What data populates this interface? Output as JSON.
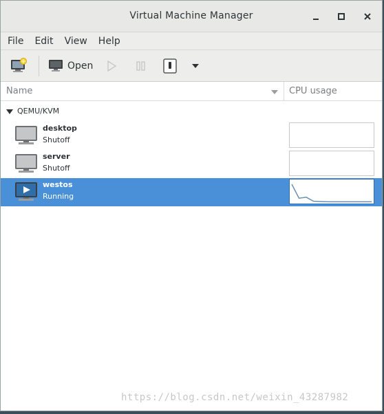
{
  "window": {
    "title": "Virtual Machine Manager"
  },
  "menu": {
    "items": [
      "File",
      "Edit",
      "View",
      "Help"
    ]
  },
  "toolbar": {
    "open_label": "Open"
  },
  "columns": {
    "name": "Name",
    "cpu": "CPU usage"
  },
  "group": {
    "label": "QEMU/KVM"
  },
  "vms": [
    {
      "name": "desktop",
      "state": "Shutoff",
      "selected": false
    },
    {
      "name": "server",
      "state": "Shutoff",
      "selected": false
    },
    {
      "name": "westos",
      "state": "Running",
      "selected": true
    }
  ],
  "cpu_usage_westos": [
    0.9,
    0.2,
    0.25,
    0.05,
    0.03,
    0.02,
    0.02,
    0.02,
    0.02,
    0.02,
    0.02,
    0.02
  ],
  "watermark": "https://blog.csdn.net/weixin_43287982",
  "colors": {
    "selection": "#4a90d9",
    "graph_line": "#6a8fb3"
  }
}
